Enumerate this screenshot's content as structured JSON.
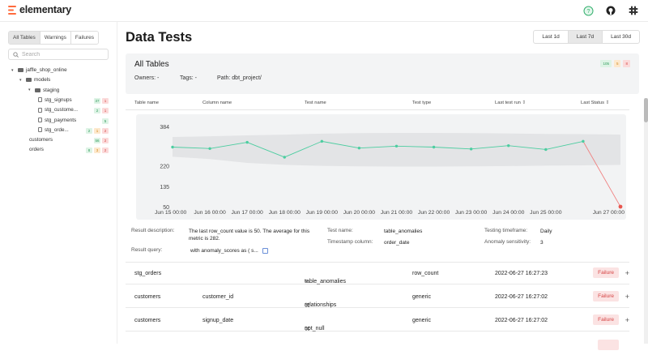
{
  "app": {
    "brand": "elementary"
  },
  "sidebar": {
    "tabs": [
      "All Tables",
      "Warnings",
      "Failures"
    ],
    "search_placeholder": "Search",
    "tree": [
      {
        "label": "jaffle_shop_online",
        "level": 0,
        "kind": "folder",
        "caret": "▾",
        "badges": []
      },
      {
        "label": "models",
        "level": 1,
        "kind": "folder",
        "caret": "▾",
        "badges": []
      },
      {
        "label": "staging",
        "level": 2,
        "kind": "folder",
        "caret": "▾",
        "badges": []
      },
      {
        "label": "stg_signups",
        "level": 3,
        "kind": "file",
        "caret": "",
        "badges": [
          {
            "v": "37",
            "c": "g"
          },
          {
            "v": "1",
            "c": "r"
          }
        ]
      },
      {
        "label": "stg_custome...",
        "level": 3,
        "kind": "file",
        "caret": "",
        "badges": [
          {
            "v": "2",
            "c": "g"
          },
          {
            "v": "1",
            "c": "r"
          }
        ]
      },
      {
        "label": "stg_payments",
        "level": 3,
        "kind": "file",
        "caret": "",
        "badges": [
          {
            "v": "5",
            "c": "g"
          }
        ]
      },
      {
        "label": "stg_orde...",
        "level": 3,
        "kind": "file",
        "caret": "",
        "badges": [
          {
            "v": "2",
            "c": "g"
          },
          {
            "v": "1",
            "c": "o"
          },
          {
            "v": "2",
            "c": "r"
          }
        ]
      },
      {
        "label": "customers",
        "level": 2,
        "kind": "file",
        "caret": "",
        "badges": [
          {
            "v": "56",
            "c": "g"
          },
          {
            "v": "2",
            "c": "r"
          }
        ]
      },
      {
        "label": "orders",
        "level": 2,
        "kind": "file",
        "caret": "",
        "badges": [
          {
            "v": "8",
            "c": "g"
          },
          {
            "v": "3",
            "c": "o"
          },
          {
            "v": "2",
            "c": "r"
          }
        ]
      }
    ]
  },
  "main": {
    "title": "Data Tests",
    "ranges": [
      "Last 1d",
      "Last 7d",
      "Last 30d"
    ],
    "summary": {
      "title": "All Tables",
      "owners": "Owners: -",
      "tags": "Tags: -",
      "path": "Path: dbt_project/",
      "counts": [
        {
          "v": "105",
          "c": "g"
        },
        {
          "v": "5",
          "c": "o"
        },
        {
          "v": "8",
          "c": "r"
        }
      ]
    },
    "columns": {
      "table_name": "Table name",
      "column_name": "Column name",
      "test_name": "Test name",
      "test_type": "Test type",
      "last_test_run": "Last test run",
      "last_status": "Last Status"
    },
    "details": {
      "result_description_label": "Result description:",
      "result_description": "The last row_count value is 50. The average for this metric is 282.",
      "result_query_label": "Result query:",
      "result_query": "with anomaly_scores as ( s...",
      "test_name_label": "Test name:",
      "test_name": "table_anomalies",
      "timestamp_column_label": "Timestamp column:",
      "timestamp_column": "order_date",
      "timeframe_label": "Testing timeframe:",
      "timeframe": "Daily",
      "sensitivity_label": "Anomaly sensitivity:",
      "sensitivity": "3"
    },
    "rows": [
      {
        "table": "stg_orders",
        "column": "",
        "test": "table_anomalies",
        "test_icon": "≡",
        "type": "row_count",
        "run": "2022-06-27 16:27:23",
        "status": "Failure"
      },
      {
        "table": "customers",
        "column": "customer_id",
        "test": "relationships",
        "test_icon": "⌘",
        "type": "generic",
        "run": "2022-06-27 16:27:02",
        "status": "Failure"
      },
      {
        "table": "customers",
        "column": "signup_date",
        "test": "not_null",
        "test_icon": "⌘",
        "type": "generic",
        "run": "2022-06-27 16:27:02",
        "status": "Failure"
      }
    ]
  },
  "chart_data": {
    "type": "line",
    "x": [
      "Jun 15 00:00",
      "Jun 16 00:00",
      "Jun 17 00:00",
      "Jun 18 00:00",
      "Jun 19 00:00",
      "Jun 20 00:00",
      "Jun 21 00:00",
      "Jun 22 00:00",
      "Jun 23 00:00",
      "Jun 24 00:00",
      "Jun 25 00:00",
      "Jun 26 00:00",
      "Jun 27 00:00"
    ],
    "x_ticks": [
      "Jun 15 00:00",
      "Jun 16 00:00",
      "Jun 17 00:00",
      "Jun 18 00:00",
      "Jun 19 00:00",
      "Jun 20 00:00",
      "Jun 21 00:00",
      "Jun 22 00:00",
      "Jun 23 00:00",
      "Jun 24 00:00",
      "Jun 25 00:00",
      "Jun 27 00:00"
    ],
    "series": [
      {
        "values": [
          298,
          292,
          318,
          256,
          322,
          294,
          302,
          298,
          290,
          304,
          288,
          322,
          50
        ]
      }
    ],
    "band_upper": [
      340,
      343,
      347,
      350,
      354,
      356,
      357,
      357,
      356,
      355,
      353,
      352,
      350
    ],
    "band_lower": [
      258,
      248,
      232,
      224,
      220,
      218,
      217,
      217,
      218,
      219,
      221,
      222,
      224
    ],
    "y_ticks": [
      50,
      135,
      220,
      384
    ],
    "ylim": [
      50,
      384
    ],
    "colors": {
      "line": "#4ccda0",
      "anomaly": "#f08080",
      "band": "#e3e4e6"
    }
  }
}
